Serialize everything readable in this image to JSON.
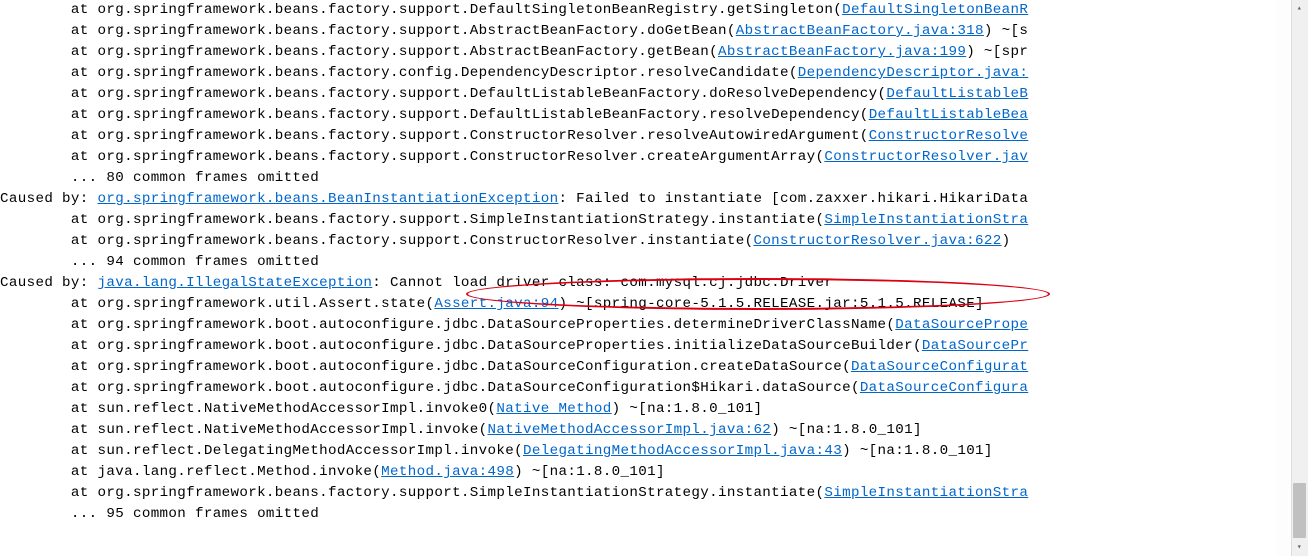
{
  "stacktrace": {
    "lines": [
      {
        "indent": "\tat ",
        "text1": "org.springframework.beans.factory.support.DefaultSingletonBeanRegistry.getSingleton(",
        "link": "DefaultSingletonBeanR",
        "text2": ""
      },
      {
        "indent": "\tat ",
        "text1": "org.springframework.beans.factory.support.AbstractBeanFactory.doGetBean(",
        "link": "AbstractBeanFactory.java:318",
        "text2": ") ~[s"
      },
      {
        "indent": "\tat ",
        "text1": "org.springframework.beans.factory.support.AbstractBeanFactory.getBean(",
        "link": "AbstractBeanFactory.java:199",
        "text2": ") ~[spr"
      },
      {
        "indent": "\tat ",
        "text1": "org.springframework.beans.factory.config.DependencyDescriptor.resolveCandidate(",
        "link": "DependencyDescriptor.java:",
        "text2": ""
      },
      {
        "indent": "\tat ",
        "text1": "org.springframework.beans.factory.support.DefaultListableBeanFactory.doResolveDependency(",
        "link": "DefaultListableB",
        "text2": ""
      },
      {
        "indent": "\tat ",
        "text1": "org.springframework.beans.factory.support.DefaultListableBeanFactory.resolveDependency(",
        "link": "DefaultListableBea",
        "text2": ""
      },
      {
        "indent": "\tat ",
        "text1": "org.springframework.beans.factory.support.ConstructorResolver.resolveAutowiredArgument(",
        "link": "ConstructorResolve",
        "text2": ""
      },
      {
        "indent": "\tat ",
        "text1": "org.springframework.beans.factory.support.ConstructorResolver.createArgumentArray(",
        "link": "ConstructorResolver.jav",
        "text2": ""
      },
      {
        "indent": "\t",
        "text1": "... 80 common frames omitted",
        "link": "",
        "text2": ""
      },
      {
        "caused": true,
        "prefix": "Caused by: ",
        "link": "org.springframework.beans.BeanInstantiationException",
        "suffix": ": Failed to instantiate [com.zaxxer.hikari.HikariData"
      },
      {
        "indent": "\tat ",
        "text1": "org.springframework.beans.factory.support.SimpleInstantiationStrategy.instantiate(",
        "link": "SimpleInstantiationStra",
        "text2": ""
      },
      {
        "indent": "\tat ",
        "text1": "org.springframework.beans.factory.support.ConstructorResolver.instantiate(",
        "link": "ConstructorResolver.java:622",
        "text2": ")"
      },
      {
        "indent": "\t",
        "text1": "... 94 common frames omitted",
        "link": "",
        "text2": ""
      },
      {
        "caused": true,
        "prefix": "Caused by: ",
        "link": "java.lang.IllegalStateException",
        "suffix": ": Cannot load driver class: com.mysql.cj.jdbc.Driver"
      },
      {
        "indent": "\tat ",
        "text1": "org.springframework.util.Assert.state(",
        "link": "Assert.java:94",
        "text2": ") ~[spring-core-5.1.5.RELEASE.jar:5.1.5.RELEASE]"
      },
      {
        "indent": "\tat ",
        "text1": "org.springframework.boot.autoconfigure.jdbc.DataSourceProperties.determineDriverClassName(",
        "link": "DataSourcePrope",
        "text2": ""
      },
      {
        "indent": "\tat ",
        "text1": "org.springframework.boot.autoconfigure.jdbc.DataSourceProperties.initializeDataSourceBuilder(",
        "link": "DataSourcePr",
        "text2": ""
      },
      {
        "indent": "\tat ",
        "text1": "org.springframework.boot.autoconfigure.jdbc.DataSourceConfiguration.createDataSource(",
        "link": "DataSourceConfigurat",
        "text2": ""
      },
      {
        "indent": "\tat ",
        "text1": "org.springframework.boot.autoconfigure.jdbc.DataSourceConfiguration$Hikari.dataSource(",
        "link": "DataSourceConfigura",
        "text2": ""
      },
      {
        "indent": "\tat ",
        "text1": "sun.reflect.NativeMethodAccessorImpl.invoke0(",
        "link": "Native Method",
        "text2": ") ~[na:1.8.0_101]"
      },
      {
        "indent": "\tat ",
        "text1": "sun.reflect.NativeMethodAccessorImpl.invoke(",
        "link": "NativeMethodAccessorImpl.java:62",
        "text2": ") ~[na:1.8.0_101]"
      },
      {
        "indent": "\tat ",
        "text1": "sun.reflect.DelegatingMethodAccessorImpl.invoke(",
        "link": "DelegatingMethodAccessorImpl.java:43",
        "text2": ") ~[na:1.8.0_101]"
      },
      {
        "indent": "\tat ",
        "text1": "java.lang.reflect.Method.invoke(",
        "link": "Method.java:498",
        "text2": ") ~[na:1.8.0_101]"
      },
      {
        "indent": "\tat ",
        "text1": "org.springframework.beans.factory.support.SimpleInstantiationStrategy.instantiate(",
        "link": "SimpleInstantiationStra",
        "text2": ""
      },
      {
        "indent": "\t",
        "text1": "... 95 common frames omitted",
        "link": "",
        "text2": ""
      }
    ]
  }
}
